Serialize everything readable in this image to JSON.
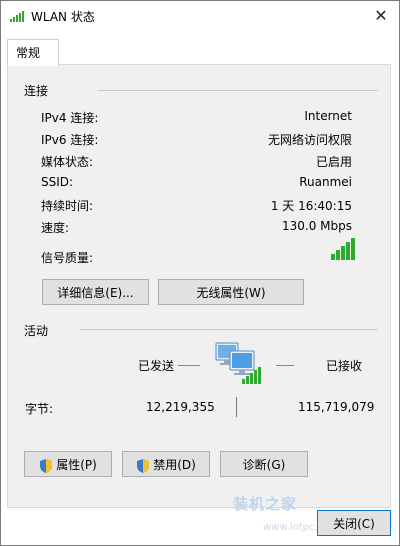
{
  "window": {
    "title": "WLAN 状态",
    "close_glyph": "✕"
  },
  "tabs": [
    {
      "label": "常规"
    }
  ],
  "connection": {
    "heading": "连接",
    "rows": [
      {
        "label": "IPv4 连接:",
        "value": "Internet"
      },
      {
        "label": "IPv6 连接:",
        "value": "无网络访问权限"
      },
      {
        "label": "媒体状态:",
        "value": "已启用"
      },
      {
        "label": "SSID:",
        "value": "Ruanmei"
      },
      {
        "label": "持续时间:",
        "value": "1 天 16:40:15"
      },
      {
        "label": "速度:",
        "value": "130.0 Mbps"
      },
      {
        "label": "信号质量:",
        "value": ""
      }
    ],
    "signal_bars": 5,
    "signal_color": "#2eaa2e",
    "buttons": {
      "details": "详细信息(E)...",
      "wireless_props": "无线属性(W)"
    }
  },
  "activity": {
    "heading": "活动",
    "sent_label": "已发送",
    "received_label": "已接收",
    "bytes_label": "字节:",
    "bytes_sent": "12,219,355",
    "bytes_received": "115,719,079"
  },
  "bottom_buttons": {
    "properties": "属性(P)",
    "disable": "禁用(D)",
    "diagnose": "诊断(G)"
  },
  "footer": {
    "close": "关闭(C)"
  },
  "watermark": {
    "brand": "装机之家",
    "url": "www.lotpc.com"
  }
}
